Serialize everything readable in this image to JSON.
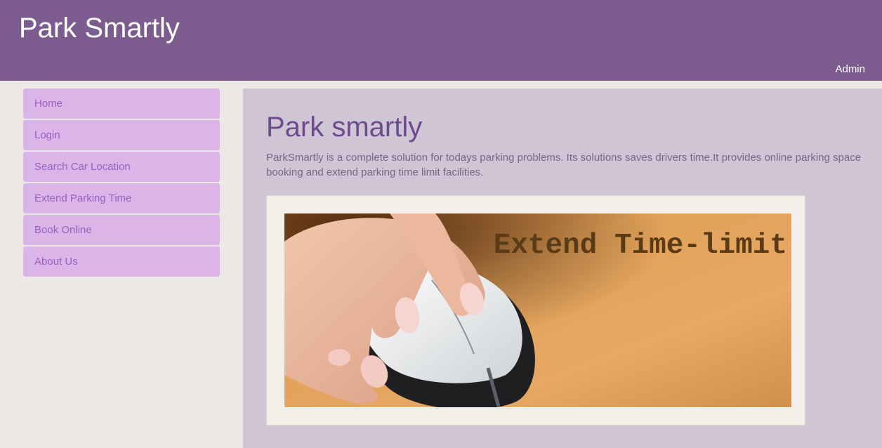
{
  "header": {
    "title": "Park Smartly",
    "admin_label": "Admin"
  },
  "sidebar": {
    "items": [
      {
        "label": "Home"
      },
      {
        "label": "Login"
      },
      {
        "label": "Search Car Location"
      },
      {
        "label": "Extend Parking Time"
      },
      {
        "label": "Book Online"
      },
      {
        "label": "About Us"
      }
    ]
  },
  "main": {
    "heading": "Park smartly",
    "description": "ParkSmartly is a complete solution for todays parking problems. Its solutions saves drivers time.It provides online parking space booking and extend parking time limit facilities.",
    "banner": {
      "caption": "Extend Time-limit",
      "icon": "hand-on-computer-mouse-image"
    }
  },
  "colors": {
    "header_bg": "#7c5c8e",
    "nav_bg": "#dbb5e8",
    "nav_text": "#9a5fc0",
    "main_bg": "#cfc5d4",
    "heading": "#6e4a8e"
  }
}
